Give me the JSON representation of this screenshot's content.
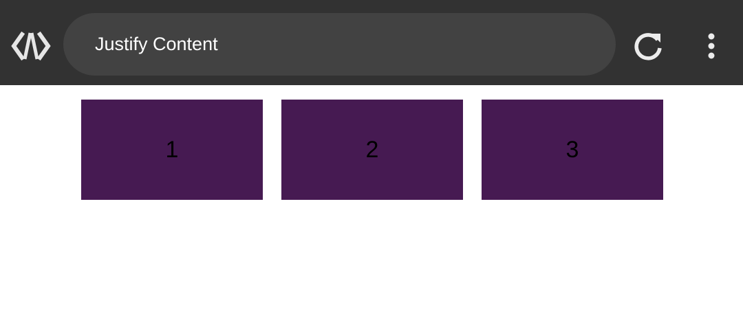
{
  "toolbar": {
    "address_text": "Justify Content",
    "logo_icon": "code-brackets-icon",
    "reload_icon": "reload-icon",
    "menu_icon": "more-vert-icon",
    "background": "#323232",
    "pill_background": "#424242"
  },
  "content": {
    "boxes": [
      {
        "label": "1"
      },
      {
        "label": "2"
      },
      {
        "label": "3"
      }
    ],
    "box_color": "#461a52"
  }
}
